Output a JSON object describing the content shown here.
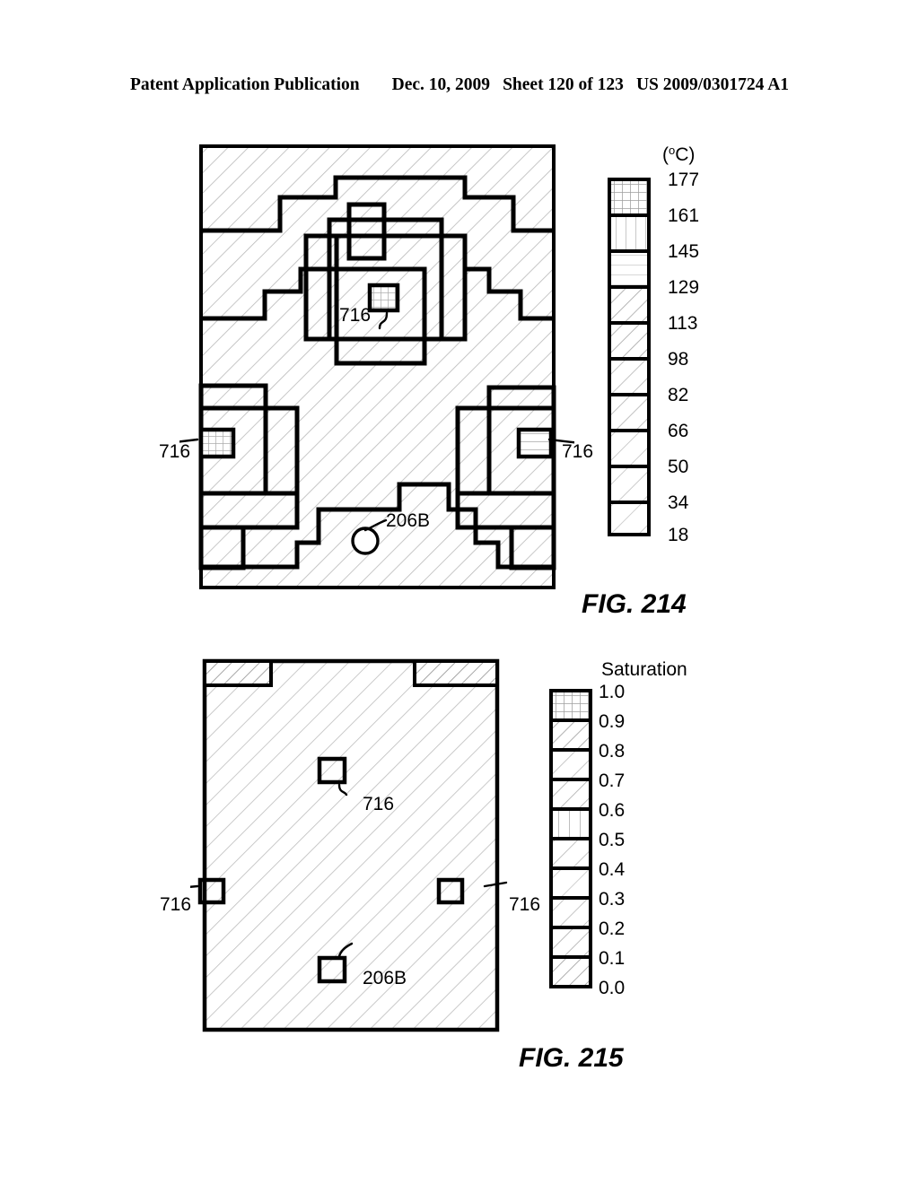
{
  "header": {
    "publication": "Patent Application Publication",
    "date": "Dec. 10, 2009",
    "sheet": "Sheet 120 of 123",
    "docnum": "US 2009/0301724 A1"
  },
  "figures": [
    {
      "id": "fig214",
      "caption": "FIG. 214",
      "colorbar": {
        "title": "(°C)",
        "title_prefix": "(",
        "title_unit": "o",
        "title_suffix": "C)",
        "labels": [
          "177",
          "161",
          "145",
          "129",
          "113",
          "98",
          "82",
          "66",
          "50",
          "34",
          "18"
        ],
        "bands": 10
      },
      "reference_labels": [
        {
          "text": "716",
          "role": "center-annotation"
        },
        {
          "text": "716",
          "role": "left-annotation"
        },
        {
          "text": "716",
          "role": "right-annotation"
        },
        {
          "text": "206B",
          "role": "bottom-annotation"
        }
      ]
    },
    {
      "id": "fig215",
      "caption": "FIG. 215",
      "colorbar": {
        "title": "Saturation",
        "labels": [
          "1.0",
          "0.9",
          "0.8",
          "0.7",
          "0.6",
          "0.5",
          "0.4",
          "0.3",
          "0.2",
          "0.1",
          "0.0"
        ],
        "bands": 10
      },
      "reference_labels": [
        {
          "text": "716",
          "role": "center-annotation"
        },
        {
          "text": "716",
          "role": "left-annotation"
        },
        {
          "text": "716",
          "role": "right-annotation"
        },
        {
          "text": "206B",
          "role": "bottom-annotation"
        }
      ]
    }
  ],
  "colors": {
    "ink": "#000000",
    "paper": "#ffffff",
    "hatch": "#b9b9b9"
  },
  "chart_data": {
    "type": "heatmap",
    "title": "FIG. 214 — Temperature contour map and FIG. 215 — Saturation contour map",
    "panels": [
      {
        "name": "FIG. 214",
        "quantity": "Temperature",
        "unit": "°C",
        "legend_position": "right",
        "contour_levels": [
          18,
          34,
          50,
          66,
          82,
          98,
          113,
          129,
          145,
          161,
          177
        ],
        "tick_labels": [
          "177",
          "161",
          "145",
          "129",
          "113",
          "98",
          "82",
          "66",
          "50",
          "34",
          "18"
        ],
        "bands": 10,
        "grid": false,
        "annotations": [
          "716",
          "716",
          "716",
          "206B"
        ],
        "description": "Nested rectilinear contour bands increasing toward the center of the domain; isolated grid-filled cells marked 716 at centre, left edge and right edge; well marker 206B near the bottom centre."
      },
      {
        "name": "FIG. 215",
        "quantity": "Saturation",
        "unit": "",
        "legend_position": "right",
        "contour_levels": [
          0.0,
          0.1,
          0.2,
          0.3,
          0.4,
          0.5,
          0.6,
          0.7,
          0.8,
          0.9,
          1.0
        ],
        "tick_labels": [
          "1.0",
          "0.9",
          "0.8",
          "0.7",
          "0.6",
          "0.5",
          "0.4",
          "0.3",
          "0.2",
          "0.1",
          "0.0"
        ],
        "bands": 10,
        "grid": false,
        "annotations": [
          "716",
          "716",
          "716",
          "206B"
        ],
        "description": "Nearly uniform saturation field over the whole domain with two small higher-saturation patches in the upper left and upper right corners; cells marked 716 at centre, left edge and right edge; well marker 206B near the bottom centre."
      }
    ]
  }
}
